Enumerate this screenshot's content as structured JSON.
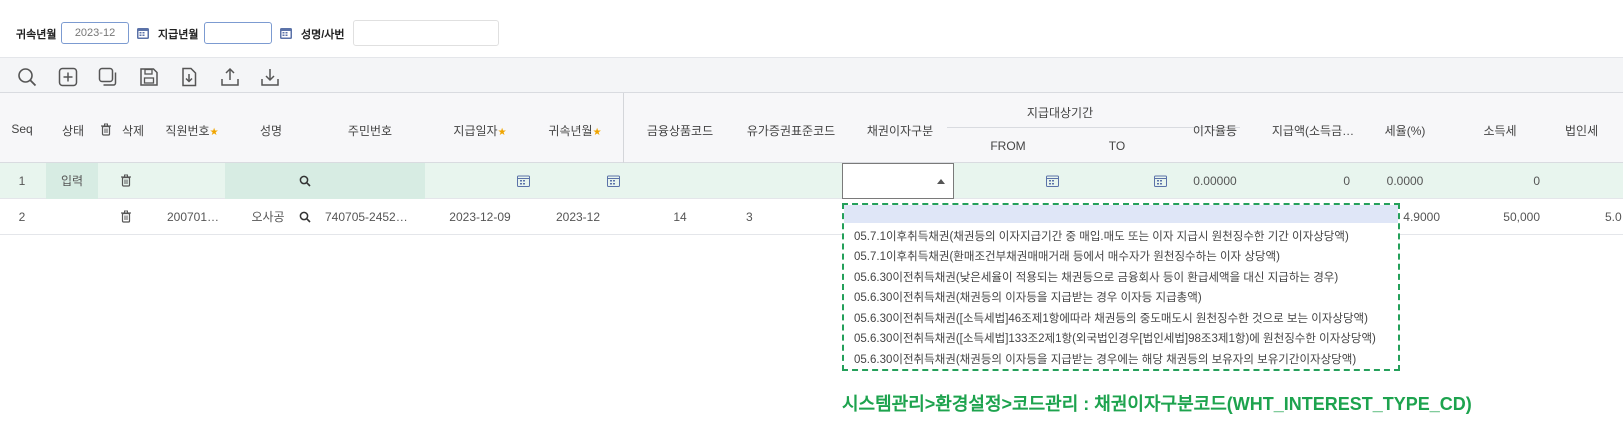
{
  "search": {
    "belong_month_label": "귀속년월",
    "belong_month_value": "2023-12",
    "pay_month_label": "지급년월",
    "pay_month_value": "",
    "name_label": "성명/사번",
    "name_value": ""
  },
  "toolbar": [
    "search-icon",
    "add-icon",
    "copy-icon",
    "save-icon",
    "download-file-icon",
    "upload-icon",
    "download-icon"
  ],
  "columns": {
    "seq": "Seq",
    "status": "상태",
    "delete": "삭제",
    "emp_no": "직원번호",
    "name": "성명",
    "rrn": "주민번호",
    "pay_date": "지급일자",
    "belong_month": "귀속년월",
    "fin_code": "금융상품코드",
    "sec_code": "유가증권표준코드",
    "bond_type": "채권이자구분",
    "period": "지급대상기간",
    "from": "FROM",
    "to": "TO",
    "interest": "이자율등",
    "pay_amount": "지급액(소득금…",
    "tax_rate": "세율(%)",
    "income_tax": "소득세",
    "corp_tax": "법인세"
  },
  "rows": [
    {
      "seq": "1",
      "status": "입력",
      "emp_no": "",
      "name": "",
      "rrn": "",
      "pay_date": "",
      "belong_month": "",
      "fin_code": "",
      "sec_code": "",
      "interest": "0.00000",
      "pay_amount": "0",
      "tax_rate": "0.0000",
      "income_tax": "0",
      "corp_tax": ""
    },
    {
      "seq": "2",
      "status": "",
      "emp_no": "200701…",
      "name": "오사공",
      "rrn": "740705-2452…",
      "pay_date": "2023-12-09",
      "belong_month": "2023-12",
      "fin_code": "14",
      "sec_code": "3",
      "interest": "",
      "pay_amount": "",
      "tax_rate": "4.9000",
      "income_tax": "50,000",
      "corp_tax": "5.0"
    }
  ],
  "dropdown_options": [
    "05.7.1이후취득채권(채권등의 이자지급기간 중 매입.매도 또는 이자 지급시 원천징수한 기간 이자상당액)",
    "05.7.1이후취득채권(환매조건부채권매매거래 등에서 매수자가 원천징수하는 이자 상당액)",
    "05.6.30이전취득채권(낮은세율이 적용되는 채권등으로 금융회사 등이 환급세액을 대신 지급하는 경우)",
    "05.6.30이전취득채권(채권등의 이자등을 지급받는 경우 이자등 지급총액)",
    "05.6.30이전취득채권([소득세법]46조제1항에따라 채권등의 중도매도시 원천징수한 것으로 보는 이자상당액)",
    "05.6.30이전취득채권([소득세법]133조2제1항(외국법인경우[법인세법]98조3제1항)에 원천징수한 이자상당액)",
    "05.6.30이전취득채권(채권등의 이자등을 지급받는 경우에는 해당 채권등의 보유자의 보유기간이자상당액)"
  ],
  "annotation": "시스템관리>환경설정>코드관리 : 채권이자구분코드(WHT_INTEREST_TYPE_CD)",
  "colors": {
    "accent_green": "#1da34e",
    "row_green": "#e8f5ee",
    "required_star": "#f0a500"
  }
}
